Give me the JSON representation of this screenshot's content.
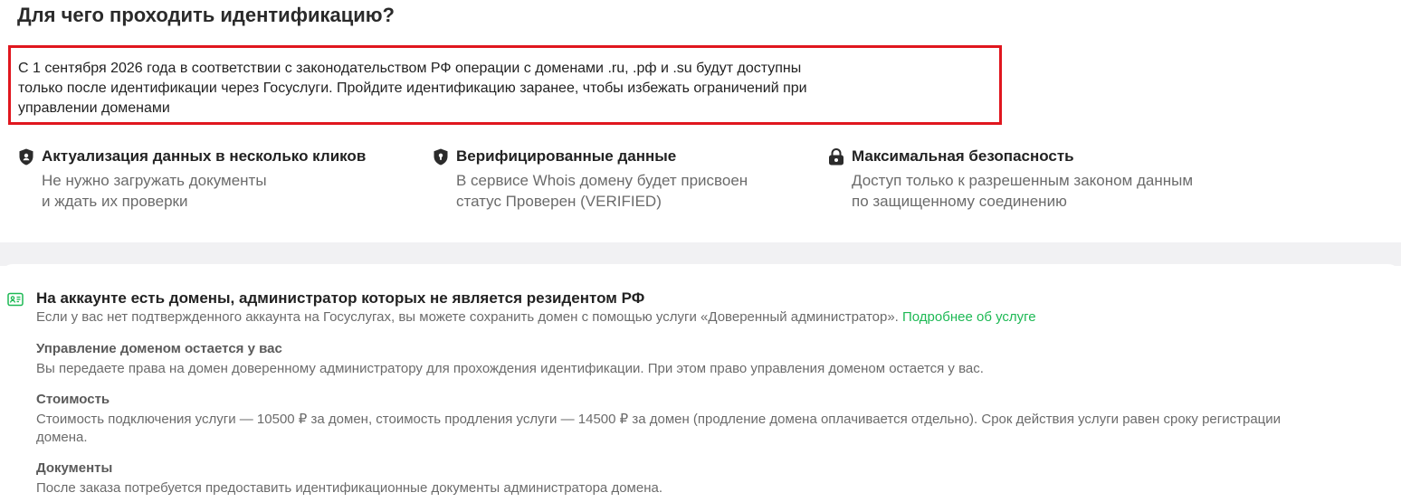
{
  "page": {
    "title": "Для чего проходить идентификацию?"
  },
  "notice": {
    "lines": [
      "С 1 сентября 2026 года в соответствии с законодательством РФ операции с доменами .ru, .рф и .su будут доступны",
      "только после идентификации через Госуслуги. Пройдите идентификацию заранее, чтобы избежать ограничений при",
      "управлении доменами"
    ],
    "border_color": "#e0161e"
  },
  "features": [
    {
      "icon": "shield-check-icon",
      "title": "Актуализация данных в несколько кликов",
      "desc": [
        "Не нужно загружать документы",
        "и ждать их проверки"
      ]
    },
    {
      "icon": "shield-lock-icon",
      "title": "Верифицированные данные",
      "desc": [
        "В сервисе Whois домену будет присвоен",
        "статус Проверен (VERIFIED)"
      ]
    },
    {
      "icon": "padlock-icon",
      "title": "Максимальная безопасность",
      "desc": [
        "Доступ только к разрешенным законом данным",
        "по защищенному соединению"
      ]
    }
  ],
  "card": {
    "icon": "id-card-icon",
    "title": "На аккаунте есть домены, администратор которых не является резидентом РФ",
    "subtitle": "Если у вас нет подтвержденного аккаунта на Госуслугах, вы можете сохранить домен с помощью услуги «Доверенный администратор».",
    "link": "Подробнее об услуге",
    "link_color": "#1db954",
    "sections": [
      {
        "title": "Управление доменом остается у вас",
        "lines": [
          "Вы передаете права на домен доверенному администратору для прохождения идентификации. При этом право управления доменом остается у вас."
        ]
      },
      {
        "title": "Стоимость",
        "lines": [
          "Стоимость подключения услуги — 10500 ₽ за домен, стоимость продления услуги — 14500 ₽ за домен (продление домена оплачивается отдельно). Срок действия услуги равен сроку регистрации",
          "домена."
        ]
      },
      {
        "title": "Документы",
        "lines": [
          "После заказа потребуется предоставить идентификационные документы администратора домена."
        ]
      }
    ]
  }
}
